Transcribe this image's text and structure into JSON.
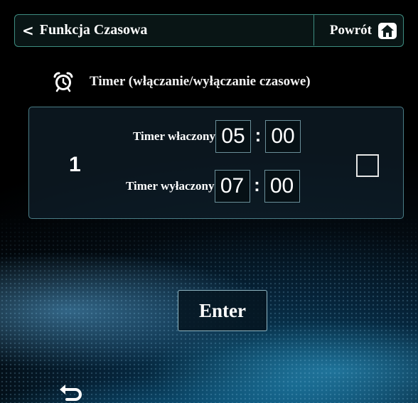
{
  "header": {
    "back_icon": "chevron-left-icon",
    "title": "Funkcja Czasowa",
    "home_label": "Powrót",
    "home_icon": "home-icon"
  },
  "timer_section": {
    "icon": "alarm-clock-icon",
    "title": "Timer (włączanie/wyłączanie czasowe)"
  },
  "timer_row": {
    "index": "1",
    "on": {
      "label": "Timer właczony",
      "hours": "05",
      "separator": ":",
      "minutes": "00"
    },
    "off": {
      "label": "Timer wyłaczony",
      "hours": "07",
      "separator": ":",
      "minutes": "00"
    },
    "enabled": false
  },
  "enter_label": "Enter",
  "footer": {
    "return_icon": "return-arrow-icon"
  }
}
